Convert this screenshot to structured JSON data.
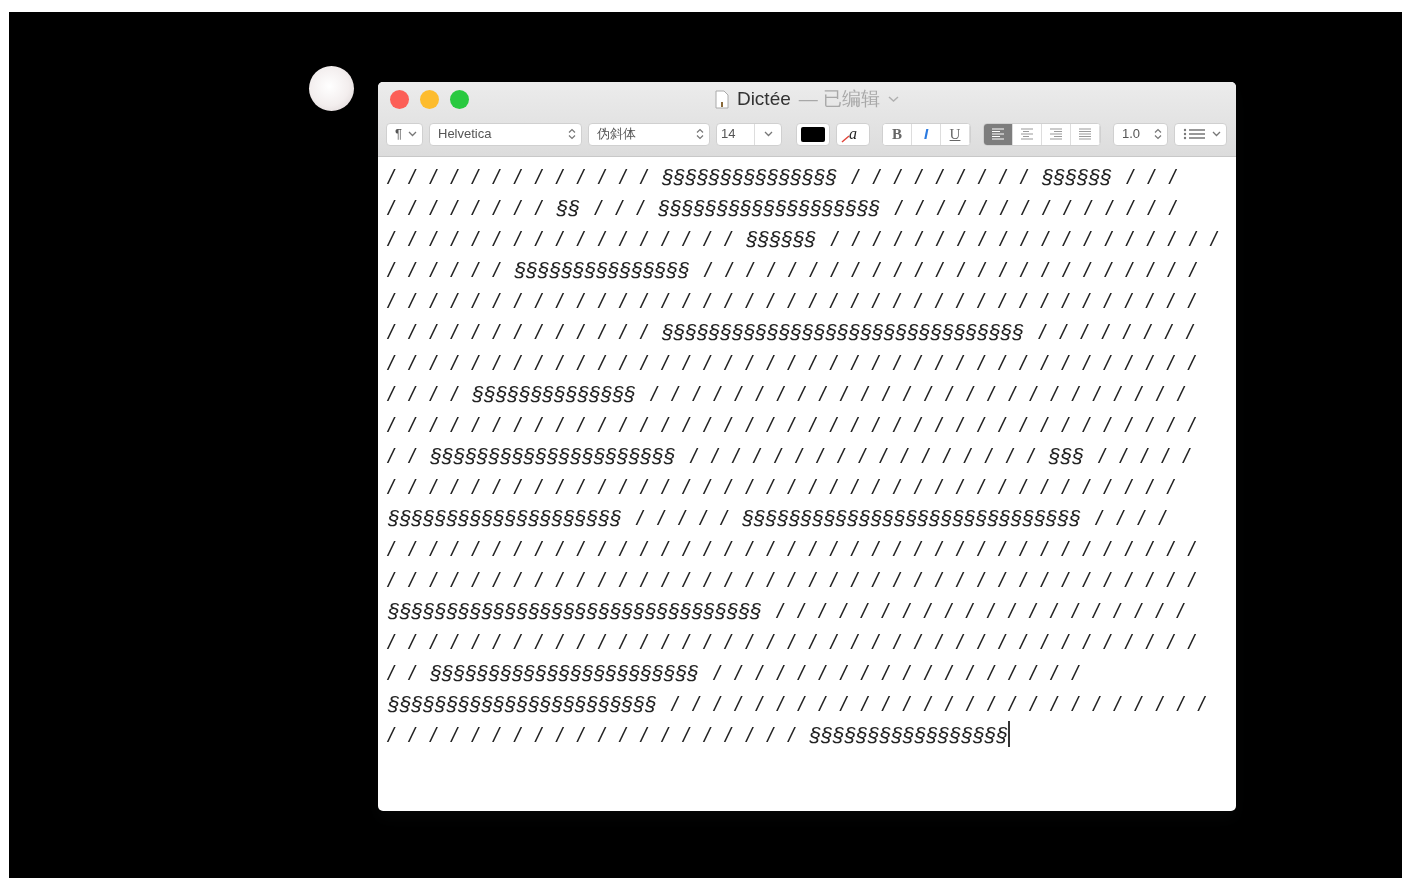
{
  "window": {
    "title": "Dictée",
    "status": "— 已编辑"
  },
  "toolbar": {
    "paragraph_menu": "¶",
    "font": "Helvetica",
    "typeface": "伪斜体",
    "size": "14",
    "background_color_symbol": "a",
    "styles": [
      {
        "label": "B",
        "kind": "bold",
        "selected": false
      },
      {
        "label": "I",
        "kind": "italic",
        "selected": true
      },
      {
        "label": "U",
        "kind": "underline",
        "selected": false
      }
    ],
    "alignments": [
      {
        "kind": "left",
        "selected": true
      },
      {
        "kind": "center",
        "selected": false
      },
      {
        "kind": "right",
        "selected": false
      },
      {
        "kind": "justify",
        "selected": false
      }
    ],
    "line_spacing": "1.0"
  },
  "document": {
    "lines": [
      "/ / / / / / / / / / / / / §§§§§§§§§§§§§§§ / / / / / / / / / §§§§§§ / / /",
      "/ / / / / / / / §§ / / / §§§§§§§§§§§§§§§§§§§ / / / / / / / / / / / / / /",
      "/ / / / / / / / / / / / / / / / / §§§§§§ / / / / / / / / / / / / / / / / / / /",
      "/ / / / / / §§§§§§§§§§§§§§§ / / / / / / / / / / / / / / / / / / / / / / / /",
      "/ / / / / / / / / / / / / / / / / / / / / / / / / / / / / / / / / / / / / / /",
      "/ / / / / / / / / / / / / §§§§§§§§§§§§§§§§§§§§§§§§§§§§§§§ / / / / / / / /",
      "/ / / / / / / / / / / / / / / / / / / / / / / / / / / / / / / / / / / / / / /",
      "/ / / / §§§§§§§§§§§§§§ / / / / / / / / / / / / / / / / / / / / / / / / / /",
      "/ / / / / / / / / / / / / / / / / / / / / / / / / / / / / / / / / / / / / / /",
      "/ / §§§§§§§§§§§§§§§§§§§§§ / / / / / / / / / / / / / / / / / §§§ / / / / /",
      "/ / / / / / / / / / / / / / / / / / / / / / / / / / / / / / / / / / / / / /",
      "§§§§§§§§§§§§§§§§§§§§ / / / / / §§§§§§§§§§§§§§§§§§§§§§§§§§§§§ / / / /",
      "/ / / / / / / / / / / / / / / / / / / / / / / / / / / / / / / / / / / / / / /",
      "/ / / / / / / / / / / / / / / / / / / / / / / / / / / / / / / / / / / / / / /",
      "§§§§§§§§§§§§§§§§§§§§§§§§§§§§§§§§ / / / / / / / / / / / / / / / / / / / /",
      "/ / / / / / / / / / / / / / / / / / / / / / / / / / / / / / / / / / / / / / /",
      "/ / §§§§§§§§§§§§§§§§§§§§§§§ / / / / / / / / / / / / / / / / / /",
      "§§§§§§§§§§§§§§§§§§§§§§§ / / / / / / / / / / / / / / / / / / / / / / / / / /",
      "/ / / / / / / / / / / / / / / / / / / / §§§§§§§§§§§§§§§§§"
    ],
    "cursor_at_end": true
  }
}
